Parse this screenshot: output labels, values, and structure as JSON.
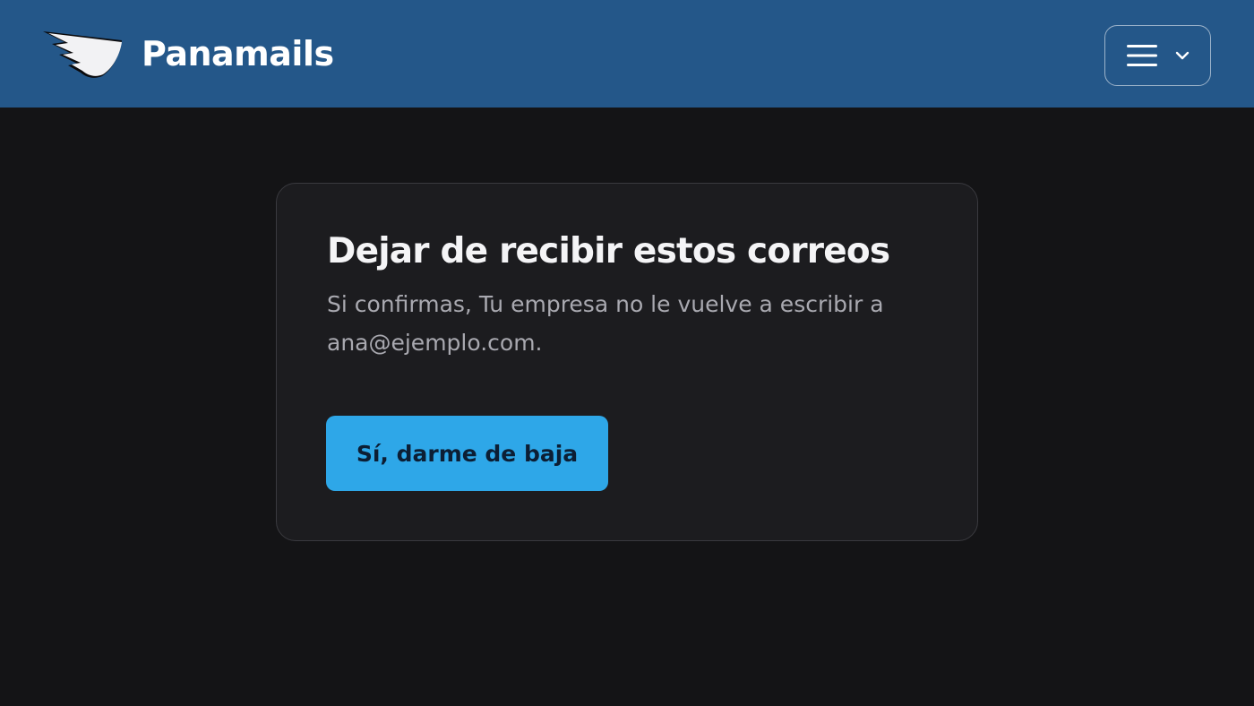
{
  "header": {
    "brand_name": "Panamails",
    "logo_icon": "wing-logo-icon",
    "menu_icons": [
      "hamburger-icon",
      "chevron-down-icon"
    ]
  },
  "card": {
    "title": "Dejar de recibir estos correos",
    "text": "Si confirmas, Tu empresa no le vuelve a escribir a ana@ejemplo.com.",
    "confirm_label": "Sí, darme de baja"
  },
  "colors": {
    "header_bg": "#245789",
    "page_bg": "#141416",
    "card_bg": "#1c1c1f",
    "accent": "#2ea7e8",
    "button_text": "#0c1e34",
    "muted_text": "#a9a9b0"
  }
}
